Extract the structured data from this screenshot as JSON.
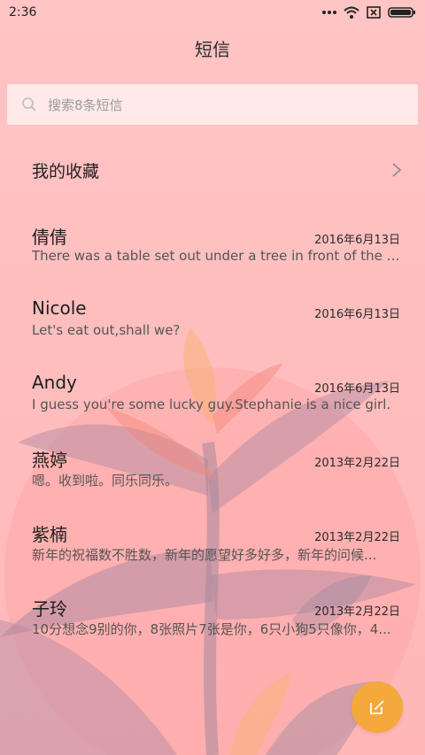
{
  "status_bar": {
    "time": "2:36"
  },
  "header": {
    "title": "短信"
  },
  "search": {
    "placeholder": "搜索8条短信"
  },
  "favorites": {
    "label": "我的收藏"
  },
  "messages": [
    {
      "name": "倩倩",
      "date": "2016年6月13日",
      "preview": "There was a table set out under a tree in front of the ho..."
    },
    {
      "name": "Nicole",
      "date": "2016年6月13日",
      "preview": "Let's eat out,shall we?"
    },
    {
      "name": "Andy",
      "date": "2016年6月13日",
      "preview": "I guess you're some lucky guy.Stephanie is a nice girl."
    },
    {
      "name": "燕婷",
      "date": "2013年2月22日",
      "preview": "嗯。收到啦。同乐同乐。"
    },
    {
      "name": "紫楠",
      "date": "2013年2月22日",
      "preview": "新年的祝福数不胜数，新年的愿望好多好多，新年的问候..."
    },
    {
      "name": "子玲",
      "date": "2013年2月22日",
      "preview": "10分想念9别的你，8张照片7张是你，6只小狗5只像你，4..."
    }
  ],
  "colors": {
    "accent": "#f5a83b",
    "background": "#ffbcbc"
  }
}
